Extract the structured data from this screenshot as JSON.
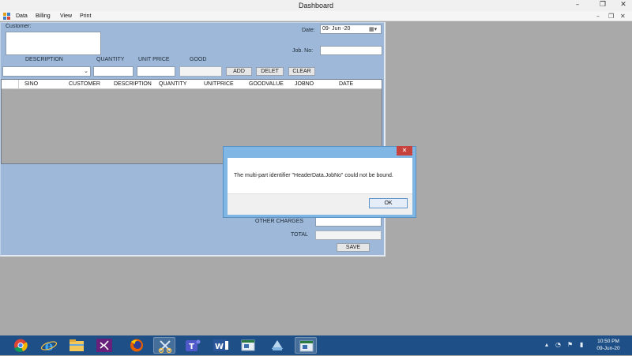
{
  "window": {
    "title": "Dashboard",
    "controls": {
      "minimize": "–",
      "maximize": "❐",
      "close": "✕"
    }
  },
  "menubar": {
    "items": [
      "Data",
      "Billing",
      "View",
      "Print"
    ],
    "mdi_controls": {
      "minimize": "–",
      "restore": "❐",
      "close": "✕"
    }
  },
  "form": {
    "customer_label": "Customer:",
    "customer_value": "",
    "date_label": "Date:",
    "date_value": "09- Jun -20",
    "jobno_label": "Job. No:",
    "jobno_value": "",
    "description_label": "DESCRIPTION",
    "quantity_label": "QUANTITY",
    "unitprice_label": "UNIT PRICE",
    "good_label": "GOOD",
    "buttons": {
      "add": "ADD",
      "delete": "DELET",
      "clear": "CLEAR",
      "save": "SAVE"
    },
    "grid_columns": [
      "SINO",
      "CUSTOMER",
      "DESCRIPTION",
      "QUANTITY",
      "UNITPRICE",
      "GOODVALUE",
      "JOBNO",
      "DATE"
    ],
    "other_charges_label": "OTHER CHARGES",
    "total_label": "TOTAL"
  },
  "dialog": {
    "message": "The multi-part identifier \"HeaderData.JobNo\" could not be bound.",
    "ok_label": "OK",
    "close_glyph": "✕"
  },
  "taskbar": {
    "apps": [
      "chrome-icon",
      "internet-explorer-icon",
      "file-explorer-icon",
      "visual-studio-icon",
      "firefox-icon",
      "snipping-tool-icon",
      "teams-icon",
      "word-icon",
      "app-window-icon",
      "generic-app-icon",
      "active-app-icon"
    ],
    "clock_time": "10:50 PM",
    "clock_date": "09-Jun-20"
  },
  "colors": {
    "form_background": "#9db8d9",
    "taskbar": "#1e4f86",
    "dialog_frame": "#7fb6e3",
    "dialog_close": "#c7413d"
  }
}
